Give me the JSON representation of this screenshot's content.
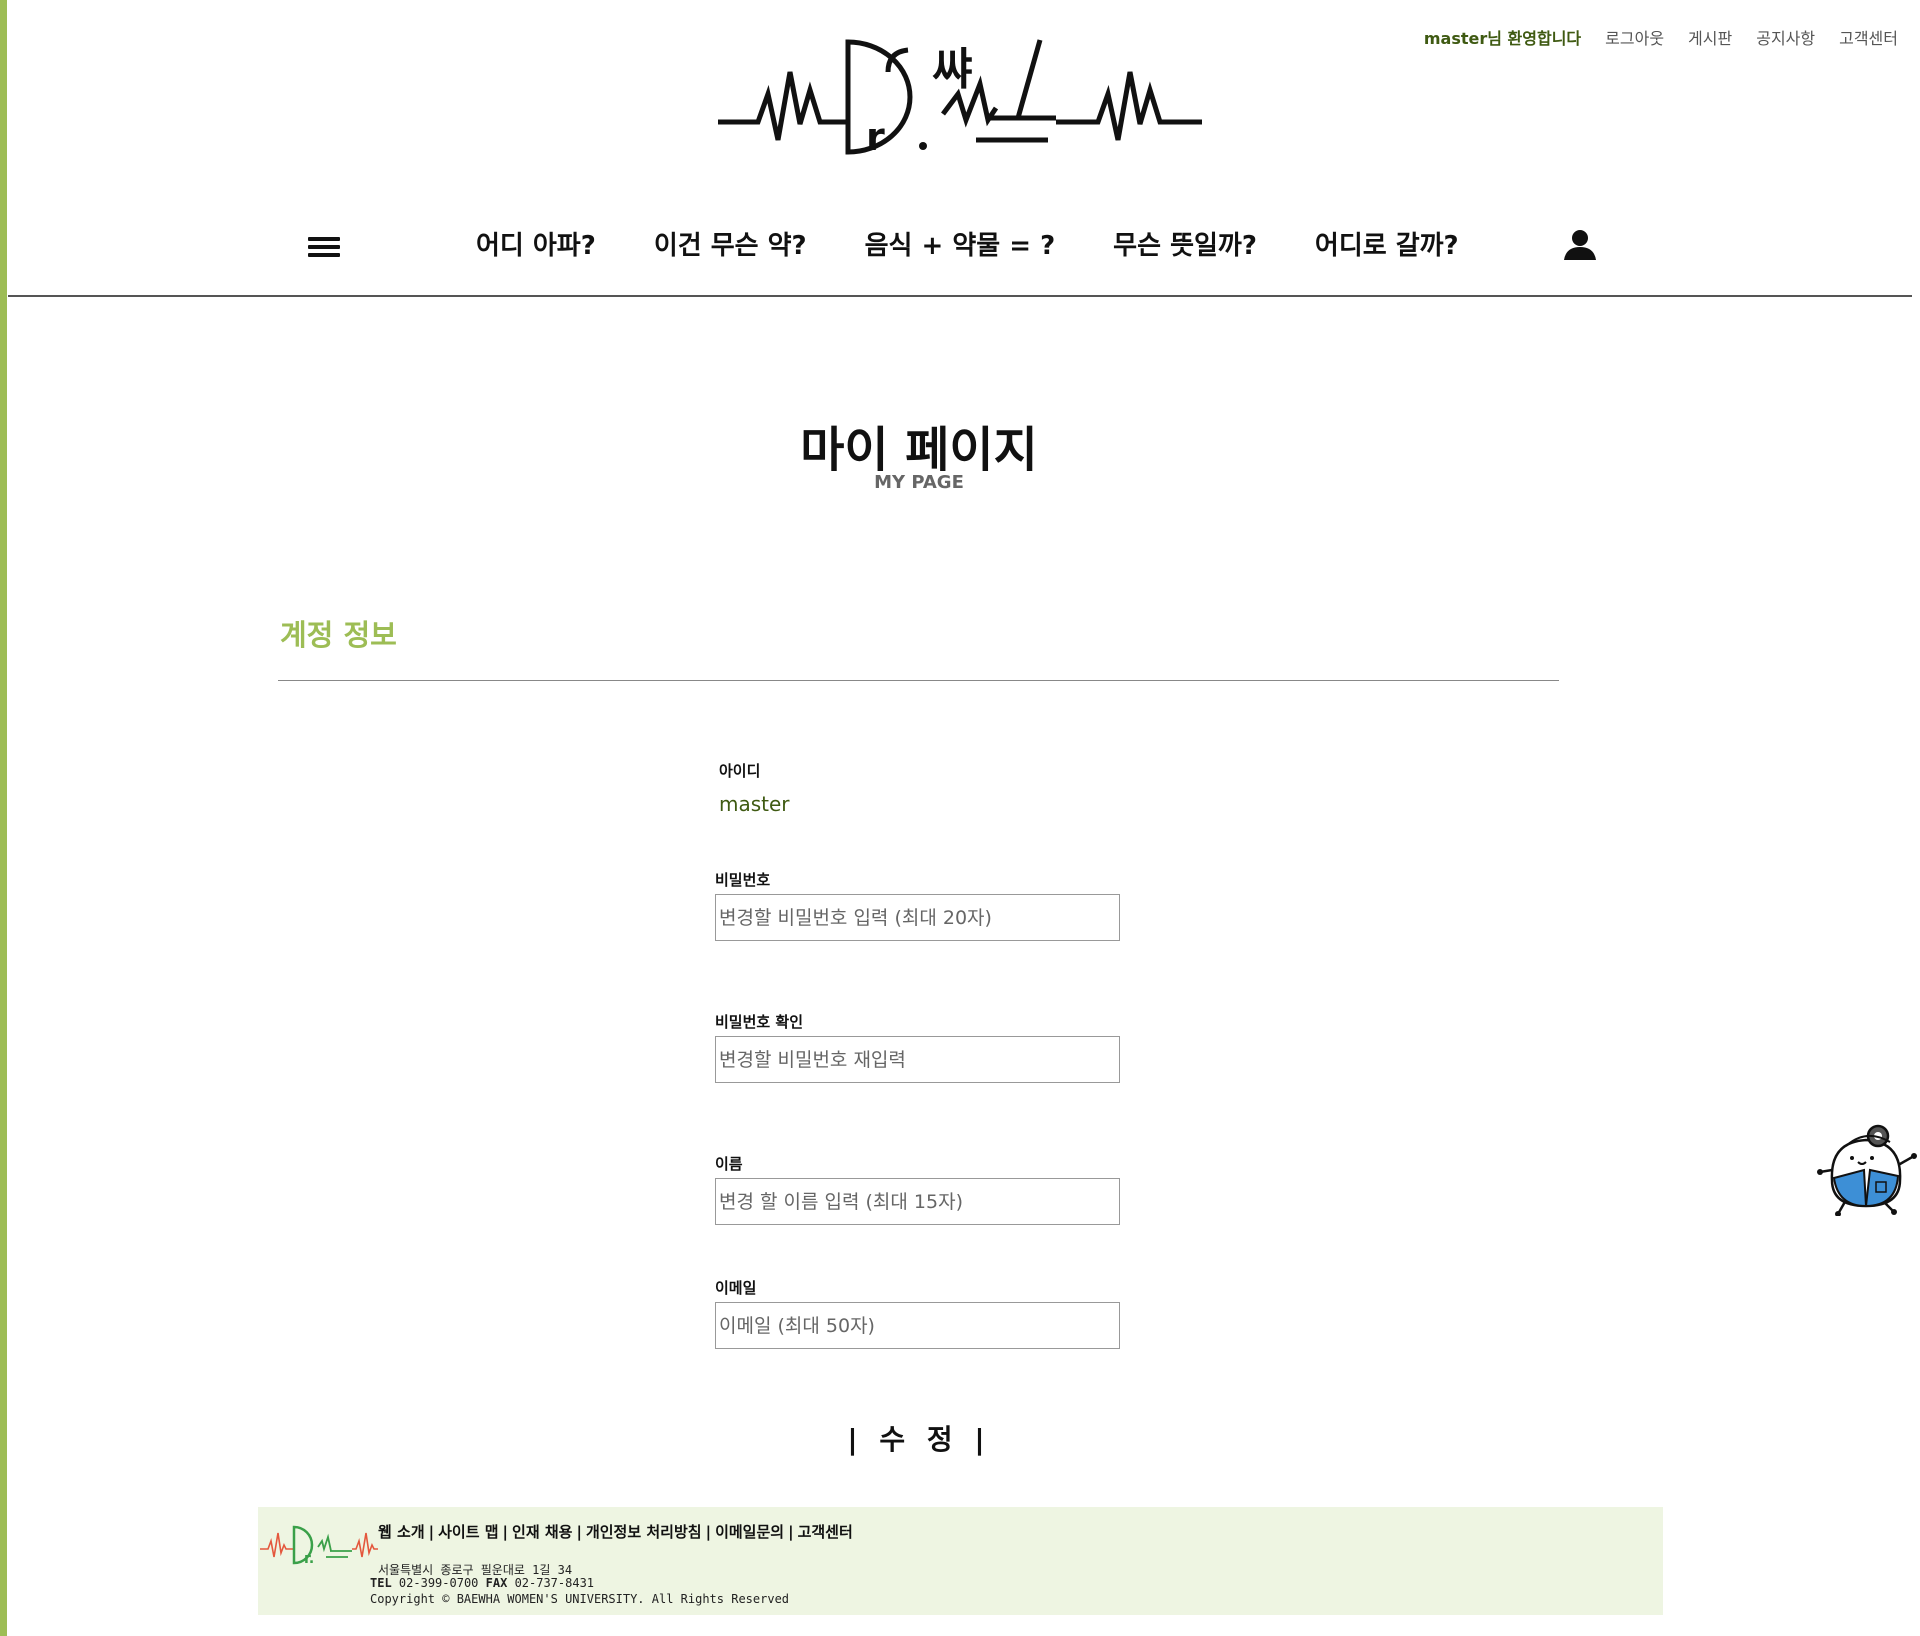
{
  "colors": {
    "accent": "#9dbd55",
    "dark_green": "#3f5a12",
    "footer_bg": "#eef5e2"
  },
  "top_bar": {
    "welcome": "master님 환영합니다",
    "links": [
      "로그아웃",
      "게시판",
      "공지사항",
      "고객센터"
    ]
  },
  "logo": {
    "text": "Dr.썬지"
  },
  "nav": {
    "menu_icon": "hamburger-menu-icon",
    "items": [
      "어디 아파?",
      "이건 무슨 약?",
      "음식 + 약물 = ?",
      "무슨 뜻일까?",
      "어디로 갈까?"
    ],
    "user_icon": "user-icon"
  },
  "page": {
    "title": "마이 페이지",
    "subtitle": "MY PAGE"
  },
  "section": {
    "title": "계정 정보"
  },
  "form": {
    "id_label": "아이디",
    "id_value": "master",
    "password_label": "비밀번호",
    "password_placeholder": "변경할 비밀번호 입력 (최대 20자)",
    "password_confirm_label": "비밀번호 확인",
    "password_confirm_placeholder": "변경할 비밀번호 재입력",
    "name_label": "이름",
    "name_placeholder": "변경 할 이름 입력 (최대 15자)",
    "email_label": "이메일",
    "email_placeholder": "이메일 (최대 50자)",
    "submit_label": "| 수 정 |"
  },
  "mascot": {
    "icon": "doctor-mascot-icon"
  },
  "footer": {
    "links": [
      "웹 소개",
      "사이트 맵",
      "인재 채용",
      "개인정보 처리방침",
      "이메일문의",
      "고객센터"
    ],
    "address": "서울특별시 종로구 필운대로 1길 34",
    "tel_label": "TEL",
    "tel": "02-399-0700",
    "fax_label": "FAX",
    "fax": "02-737-8431",
    "copyright": "Copyright © BAEWHA WOMEN'S UNIVERSITY. All Rights Reserved"
  }
}
